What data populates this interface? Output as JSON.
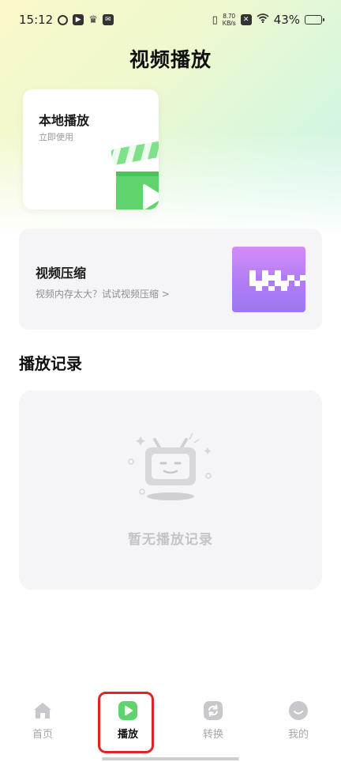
{
  "status_bar": {
    "time": "15:12",
    "net_speed_value": "8.70",
    "net_speed_unit": "KB/s",
    "battery": "43%"
  },
  "header": {
    "title": "视频播放"
  },
  "local_play": {
    "title": "本地播放",
    "subtitle": "立即使用"
  },
  "compress": {
    "title": "视频压缩",
    "subtitle": "视频内存太大？试试视频压缩 >"
  },
  "history": {
    "title": "播放记录",
    "empty_text": "暂无播放记录"
  },
  "tab_bar": {
    "tabs": [
      {
        "label": "首页",
        "icon": "home-icon",
        "active": false
      },
      {
        "label": "播放",
        "icon": "play-icon",
        "active": true
      },
      {
        "label": "转换",
        "icon": "convert-icon",
        "active": false
      },
      {
        "label": "我的",
        "icon": "profile-icon",
        "active": false
      }
    ]
  },
  "colors": {
    "accent_green": "#5fd36c",
    "highlight_red": "#e02424",
    "compress_purple": "#b07cf5"
  }
}
